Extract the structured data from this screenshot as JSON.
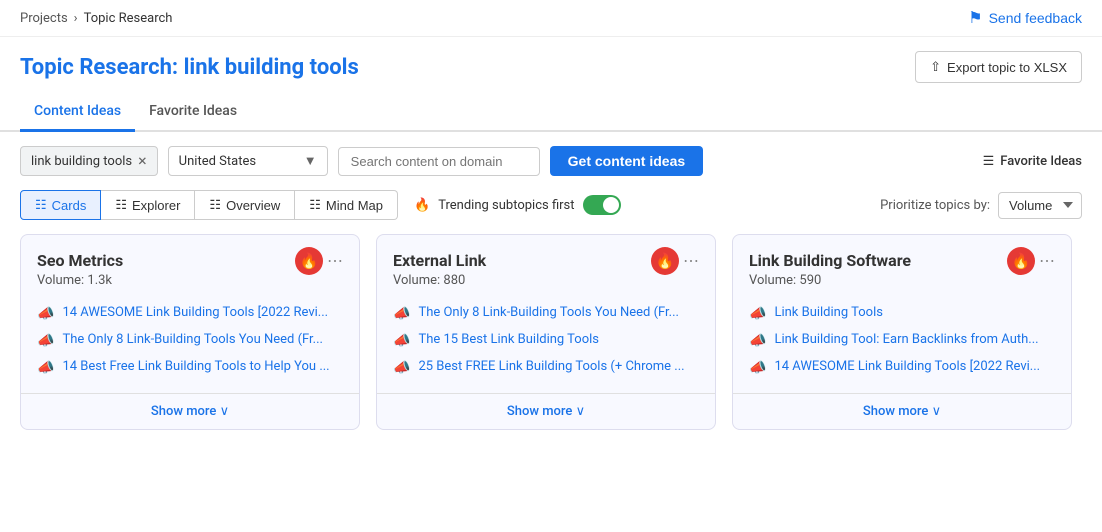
{
  "breadcrumb": {
    "projects_label": "Projects",
    "separator": "›",
    "current_label": "Topic Research"
  },
  "send_feedback": {
    "label": "Send feedback"
  },
  "page_header": {
    "title_prefix": "Topic Research:",
    "title_keyword": "link building tools",
    "export_label": "Export topic to XLSX"
  },
  "tabs": [
    {
      "id": "content-ideas",
      "label": "Content Ideas",
      "active": true
    },
    {
      "id": "favorite-ideas",
      "label": "Favorite Ideas",
      "active": false
    }
  ],
  "controls": {
    "keyword_value": "link building tools",
    "close_label": "×",
    "country_value": "United States",
    "domain_placeholder": "Search content on domain",
    "get_ideas_label": "Get content ideas",
    "favorite_ideas_label": "Favorite Ideas"
  },
  "view_controls": {
    "views": [
      {
        "id": "cards",
        "label": "Cards",
        "active": true
      },
      {
        "id": "explorer",
        "label": "Explorer",
        "active": false
      },
      {
        "id": "overview",
        "label": "Overview",
        "active": false
      },
      {
        "id": "mind-map",
        "label": "Mind Map",
        "active": false
      }
    ],
    "trending_label": "Trending subtopics first",
    "trending_on": true,
    "prioritize_label": "Prioritize topics by:",
    "prioritize_value": "Volume"
  },
  "cards": [
    {
      "id": "seo-metrics",
      "title": "Seo Metrics",
      "volume": "Volume: 1.3k",
      "trending": true,
      "items": [
        "14 AWESOME Link Building Tools [2022 Revi...",
        "The Only 8 Link-Building Tools You Need (Fr...",
        "14 Best Free Link Building Tools to Help You ..."
      ],
      "show_more": "Show more ∨"
    },
    {
      "id": "external-link",
      "title": "External Link",
      "volume": "Volume: 880",
      "trending": true,
      "items": [
        "The Only 8 Link-Building Tools You Need (Fr...",
        "The 15 Best Link Building Tools",
        "25 Best FREE Link Building Tools (+ Chrome ..."
      ],
      "show_more": "Show more ∨"
    },
    {
      "id": "link-building-software",
      "title": "Link Building Software",
      "volume": "Volume: 590",
      "trending": true,
      "items": [
        "Link Building Tools",
        "Link Building Tool: Earn Backlinks from Auth...",
        "14 AWESOME Link Building Tools [2022 Revi..."
      ],
      "show_more": "Show more ∨"
    }
  ]
}
